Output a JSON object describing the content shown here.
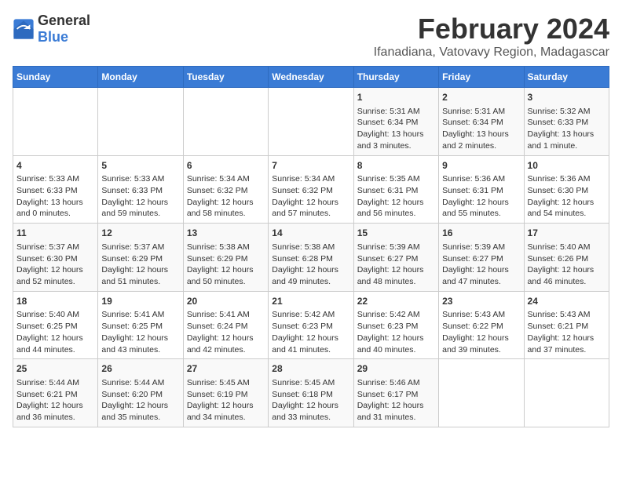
{
  "logo": {
    "general": "General",
    "blue": "Blue"
  },
  "title": "February 2024",
  "subtitle": "Ifanadiana, Vatovavy Region, Madagascar",
  "days_of_week": [
    "Sunday",
    "Monday",
    "Tuesday",
    "Wednesday",
    "Thursday",
    "Friday",
    "Saturday"
  ],
  "weeks": [
    [
      {
        "day": "",
        "content": ""
      },
      {
        "day": "",
        "content": ""
      },
      {
        "day": "",
        "content": ""
      },
      {
        "day": "",
        "content": ""
      },
      {
        "day": "1",
        "content": "Sunrise: 5:31 AM\nSunset: 6:34 PM\nDaylight: 13 hours\nand 3 minutes."
      },
      {
        "day": "2",
        "content": "Sunrise: 5:31 AM\nSunset: 6:34 PM\nDaylight: 13 hours\nand 2 minutes."
      },
      {
        "day": "3",
        "content": "Sunrise: 5:32 AM\nSunset: 6:33 PM\nDaylight: 13 hours\nand 1 minute."
      }
    ],
    [
      {
        "day": "4",
        "content": "Sunrise: 5:33 AM\nSunset: 6:33 PM\nDaylight: 13 hours\nand 0 minutes."
      },
      {
        "day": "5",
        "content": "Sunrise: 5:33 AM\nSunset: 6:33 PM\nDaylight: 12 hours\nand 59 minutes."
      },
      {
        "day": "6",
        "content": "Sunrise: 5:34 AM\nSunset: 6:32 PM\nDaylight: 12 hours\nand 58 minutes."
      },
      {
        "day": "7",
        "content": "Sunrise: 5:34 AM\nSunset: 6:32 PM\nDaylight: 12 hours\nand 57 minutes."
      },
      {
        "day": "8",
        "content": "Sunrise: 5:35 AM\nSunset: 6:31 PM\nDaylight: 12 hours\nand 56 minutes."
      },
      {
        "day": "9",
        "content": "Sunrise: 5:36 AM\nSunset: 6:31 PM\nDaylight: 12 hours\nand 55 minutes."
      },
      {
        "day": "10",
        "content": "Sunrise: 5:36 AM\nSunset: 6:30 PM\nDaylight: 12 hours\nand 54 minutes."
      }
    ],
    [
      {
        "day": "11",
        "content": "Sunrise: 5:37 AM\nSunset: 6:30 PM\nDaylight: 12 hours\nand 52 minutes."
      },
      {
        "day": "12",
        "content": "Sunrise: 5:37 AM\nSunset: 6:29 PM\nDaylight: 12 hours\nand 51 minutes."
      },
      {
        "day": "13",
        "content": "Sunrise: 5:38 AM\nSunset: 6:29 PM\nDaylight: 12 hours\nand 50 minutes."
      },
      {
        "day": "14",
        "content": "Sunrise: 5:38 AM\nSunset: 6:28 PM\nDaylight: 12 hours\nand 49 minutes."
      },
      {
        "day": "15",
        "content": "Sunrise: 5:39 AM\nSunset: 6:27 PM\nDaylight: 12 hours\nand 48 minutes."
      },
      {
        "day": "16",
        "content": "Sunrise: 5:39 AM\nSunset: 6:27 PM\nDaylight: 12 hours\nand 47 minutes."
      },
      {
        "day": "17",
        "content": "Sunrise: 5:40 AM\nSunset: 6:26 PM\nDaylight: 12 hours\nand 46 minutes."
      }
    ],
    [
      {
        "day": "18",
        "content": "Sunrise: 5:40 AM\nSunset: 6:25 PM\nDaylight: 12 hours\nand 44 minutes."
      },
      {
        "day": "19",
        "content": "Sunrise: 5:41 AM\nSunset: 6:25 PM\nDaylight: 12 hours\nand 43 minutes."
      },
      {
        "day": "20",
        "content": "Sunrise: 5:41 AM\nSunset: 6:24 PM\nDaylight: 12 hours\nand 42 minutes."
      },
      {
        "day": "21",
        "content": "Sunrise: 5:42 AM\nSunset: 6:23 PM\nDaylight: 12 hours\nand 41 minutes."
      },
      {
        "day": "22",
        "content": "Sunrise: 5:42 AM\nSunset: 6:23 PM\nDaylight: 12 hours\nand 40 minutes."
      },
      {
        "day": "23",
        "content": "Sunrise: 5:43 AM\nSunset: 6:22 PM\nDaylight: 12 hours\nand 39 minutes."
      },
      {
        "day": "24",
        "content": "Sunrise: 5:43 AM\nSunset: 6:21 PM\nDaylight: 12 hours\nand 37 minutes."
      }
    ],
    [
      {
        "day": "25",
        "content": "Sunrise: 5:44 AM\nSunset: 6:21 PM\nDaylight: 12 hours\nand 36 minutes."
      },
      {
        "day": "26",
        "content": "Sunrise: 5:44 AM\nSunset: 6:20 PM\nDaylight: 12 hours\nand 35 minutes."
      },
      {
        "day": "27",
        "content": "Sunrise: 5:45 AM\nSunset: 6:19 PM\nDaylight: 12 hours\nand 34 minutes."
      },
      {
        "day": "28",
        "content": "Sunrise: 5:45 AM\nSunset: 6:18 PM\nDaylight: 12 hours\nand 33 minutes."
      },
      {
        "day": "29",
        "content": "Sunrise: 5:46 AM\nSunset: 6:17 PM\nDaylight: 12 hours\nand 31 minutes."
      },
      {
        "day": "",
        "content": ""
      },
      {
        "day": "",
        "content": ""
      }
    ]
  ]
}
